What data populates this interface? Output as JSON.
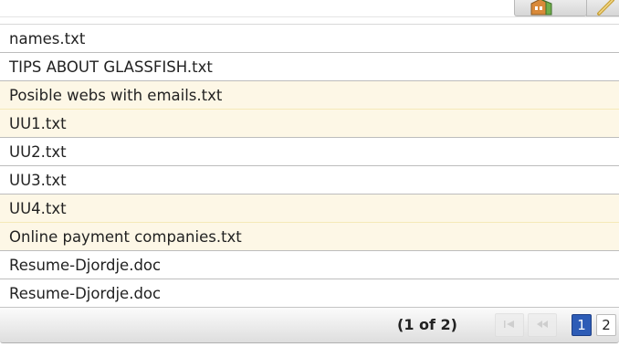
{
  "toolbar": {
    "buttons": [
      {
        "icon": "building-icon"
      },
      {
        "icon": "pencil-icon"
      }
    ]
  },
  "files": [
    {
      "name": "names.txt",
      "highlighted": false
    },
    {
      "name": "TIPS ABOUT GLASSFISH.txt",
      "highlighted": false
    },
    {
      "name": "Posible webs with emails.txt",
      "highlighted": true
    },
    {
      "name": "UU1.txt",
      "highlighted": true
    },
    {
      "name": "UU2.txt",
      "highlighted": false
    },
    {
      "name": "UU3.txt",
      "highlighted": false
    },
    {
      "name": "UU4.txt",
      "highlighted": true
    },
    {
      "name": "Online payment companies.txt",
      "highlighted": true
    },
    {
      "name": "Resume-Djordje.doc",
      "highlighted": false
    },
    {
      "name": "Resume-Djordje.doc",
      "highlighted": false
    }
  ],
  "paginator": {
    "status": "(1 of 2)",
    "first_icon": "first-page-icon",
    "prev_icon": "previous-page-icon",
    "pages": [
      "1",
      "2"
    ],
    "current_page": "1"
  },
  "colors": {
    "highlight_row": "#fdf7e6",
    "active_page": "#2d5cb6"
  }
}
